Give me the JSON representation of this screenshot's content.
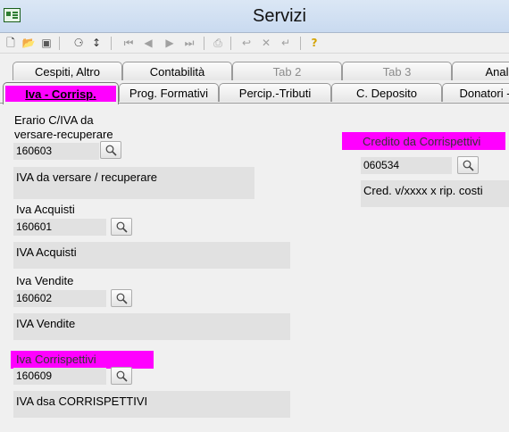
{
  "window": {
    "title": "Servizi"
  },
  "toolbar": {
    "icons": [
      "new-icon",
      "open-icon",
      "save-icon",
      "find-icon",
      "move-icon",
      "first-icon",
      "prev-icon",
      "next-icon",
      "last-icon",
      "print-icon",
      "link-icon",
      "delete-icon",
      "insert-icon",
      "help-icon"
    ]
  },
  "tabs_row1": [
    {
      "label": "Cespiti, Altro"
    },
    {
      "label": "Contabilità"
    },
    {
      "label": "Tab 2"
    },
    {
      "label": "Tab 3"
    },
    {
      "label": "Anal"
    }
  ],
  "tabs_row2": [
    {
      "label": "Iva - Corrisp."
    },
    {
      "label": "Prog. Formativi"
    },
    {
      "label": "Percip.-Tributi"
    },
    {
      "label": "C. Deposito"
    },
    {
      "label": "Donatori -"
    }
  ],
  "fields": {
    "erario": {
      "label": "Erario C/IVA da\nversare-recuperare",
      "code": "160603",
      "description": "IVA da versare / recuperare"
    },
    "acquisti": {
      "label": "Iva Acquisti",
      "code": "160601",
      "description": "IVA Acquisti"
    },
    "vendite": {
      "label": "Iva Vendite",
      "code": "160602",
      "description": "IVA Vendite"
    },
    "corrispettivi": {
      "label": "Iva Corrispettivi",
      "code": "160609",
      "description": "IVA dsa CORRISPETTIVI"
    },
    "credito": {
      "label": "Credito da Corrispettivi",
      "code": "060534",
      "description": "Cred. v/xxxx x rip. costi"
    }
  },
  "colors": {
    "highlight": "#ff00ff",
    "field_bg": "#e1e1e1"
  }
}
